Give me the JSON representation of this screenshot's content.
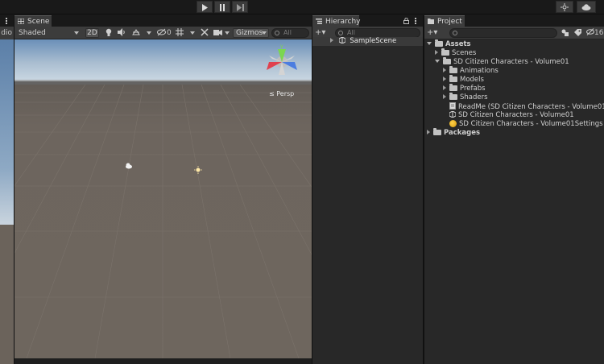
{
  "playbar": {
    "play_icon": "play-icon",
    "pause_icon": "pause-icon",
    "step_icon": "step-icon"
  },
  "left_panel": {
    "partial_label": "dio"
  },
  "scene": {
    "tab_label": "Scene",
    "shading_mode": "Shaded",
    "mode_2d": "2D",
    "hidden_count": "0",
    "gizmos_label": "Gizmos",
    "search_placeholder": "All",
    "persp_label": "≤ Persp",
    "gizmo_y": "y",
    "colors": {
      "sky_top": "#6a8fb8",
      "sky_horizon": "#cbd8e3",
      "ground": "#6e665e"
    }
  },
  "hierarchy": {
    "tab_label": "Hierarchy",
    "add_label": "+▾",
    "search_placeholder": "All",
    "items": [
      {
        "label": "SampleScene"
      }
    ]
  },
  "project": {
    "tab_label": "Project",
    "add_label": "+▾",
    "count_label": "16",
    "tree": [
      {
        "label": "Assets",
        "type": "folder",
        "expanded": true,
        "bold": true
      },
      {
        "label": "Scenes",
        "type": "folder"
      },
      {
        "label": "SD Citizen Characters - Volume01",
        "type": "folder",
        "expanded": true
      },
      {
        "label": "Animations",
        "type": "folder"
      },
      {
        "label": "Models",
        "type": "folder"
      },
      {
        "label": "Prefabs",
        "type": "folder"
      },
      {
        "label": "Shaders",
        "type": "folder"
      },
      {
        "label": "ReadMe (SD Citizen Characters - Volume01)",
        "type": "readme"
      },
      {
        "label": "SD Citizen Characters - Volume01",
        "type": "scene"
      },
      {
        "label": "SD Citizen Characters - Volume01Settings",
        "type": "settings"
      },
      {
        "label": "Packages",
        "type": "folder",
        "bold": true
      }
    ]
  }
}
